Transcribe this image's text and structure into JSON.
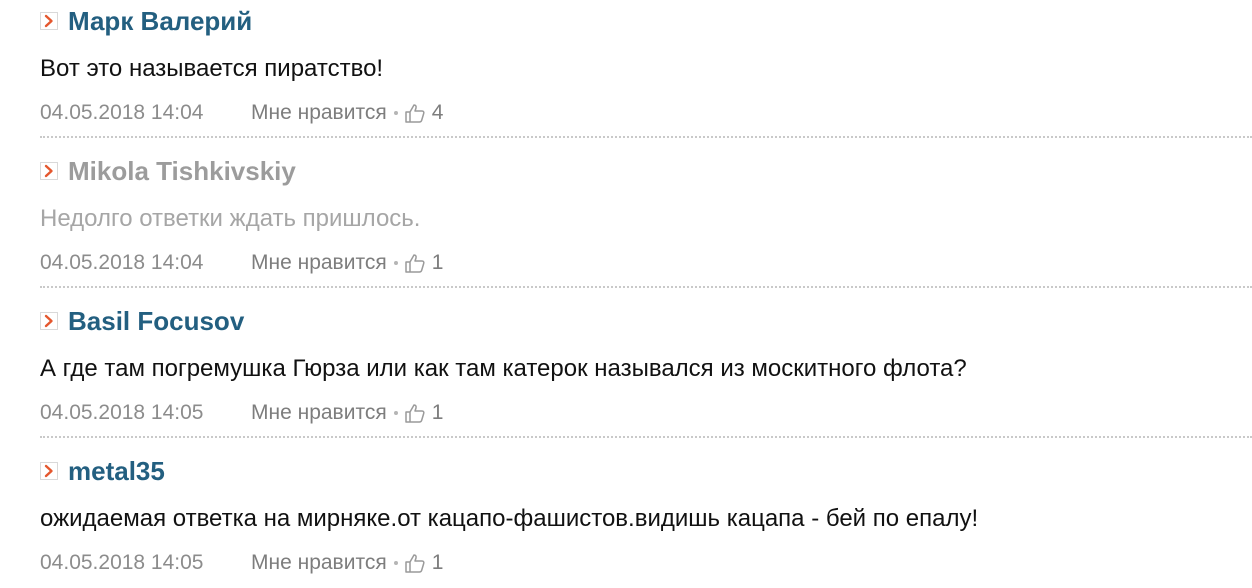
{
  "comments": [
    {
      "author": "Марк Валерий",
      "text": "Вот это называется пиратство!",
      "date": "04.05.2018 14:04",
      "like_label": "Мне нравится",
      "likes": "4",
      "faded": false
    },
    {
      "author": "Mikola Tishkivskiy",
      "text": "Недолго ответки ждать пришлось.",
      "date": "04.05.2018 14:04",
      "like_label": "Мне нравится",
      "likes": "1",
      "faded": true
    },
    {
      "author": "Basil Focusov",
      "text": "А где там погремушка Гюрза или как там катерок назывался из москитного флота?",
      "date": "04.05.2018 14:05",
      "like_label": "Мне нравится",
      "likes": "1",
      "faded": false
    },
    {
      "author": "metal35",
      "text": "ожидаемая ответка на мирняке.от кацапо-фашистов.видишь кацапа - бей по епалу!",
      "date": "04.05.2018 14:05",
      "like_label": "Мне нравится",
      "likes": "1",
      "faded": false
    }
  ],
  "icons": {
    "author_marker": "chevron-right-icon",
    "like": "thumbs-up-icon"
  },
  "colors": {
    "author": "#235f80",
    "author_faded": "#9c9c9c",
    "marker_arrow": "#e4572e",
    "text": "#111111",
    "text_faded": "#a6a6a6",
    "meta": "#8c8c8c"
  }
}
